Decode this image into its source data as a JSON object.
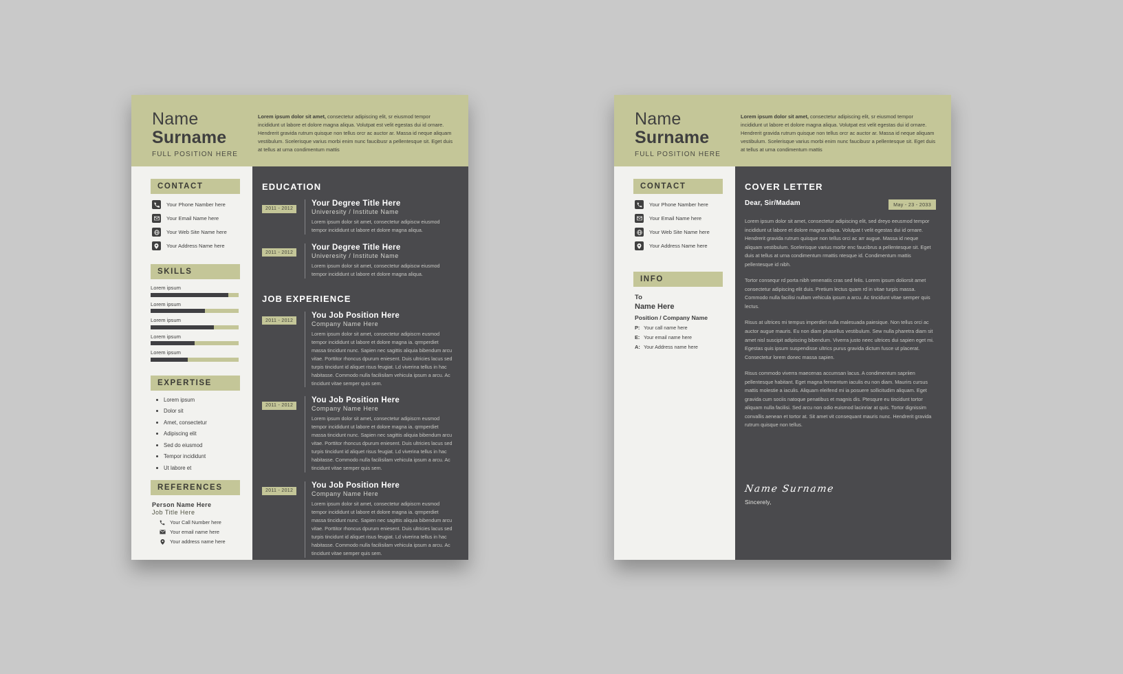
{
  "header": {
    "name": "Name",
    "surname": "Surname",
    "role": "FULL POSITION HERE",
    "intro_bold": "Lorem ipsum dolor sit amet,",
    "intro_rest": " consectetur adipiscing elit, sr eiusmod tempor incididunt ut labore et dolore magna aliqua. Volutpat est velit egestas dui id ornare. Hendrerit gravida rutrum quisque non tellus orcr ac auctor ar. Massa id neque aliquam vestibulum. Scelerisque varius morbi enim nunc faucibusr a pellentesque sit. Eget duis at tellus at urna condimentum mattis"
  },
  "contact": {
    "title": "CONTACT",
    "items": [
      {
        "icon": "phone-icon",
        "text": "Your Phone Namber here"
      },
      {
        "icon": "email-icon",
        "text": "Your Email Name here"
      },
      {
        "icon": "website-icon",
        "text": "Your Web Site Name here"
      },
      {
        "icon": "location-icon",
        "text": "Your Address Name here"
      }
    ]
  },
  "skills": {
    "title": "SKILLS",
    "items": [
      {
        "label": "Lorem ipsum",
        "percent": 88
      },
      {
        "label": "Lorem ipsum",
        "percent": 62
      },
      {
        "label": "Lorem ipsum",
        "percent": 72
      },
      {
        "label": "Lorem ipsum",
        "percent": 50
      },
      {
        "label": "Lorem ipsum",
        "percent": 42
      }
    ]
  },
  "expertise": {
    "title": "EXPERTISE",
    "items": [
      "Lorem ipsum",
      "Dolor sit",
      "Amet, consectetur",
      "Adipiscing elit",
      "Sed do eiusmod",
      "Tempor incididunt",
      "Ut labore et"
    ]
  },
  "references": {
    "title": "REFERENCES",
    "person_name": "Person Name Here",
    "job_title": "Job Title Here",
    "items": [
      {
        "icon": "phone-icon",
        "text": "Your  Call Number here"
      },
      {
        "icon": "email-icon",
        "text": "Your email name here"
      },
      {
        "icon": "location-icon",
        "text": "Your address name here"
      }
    ]
  },
  "education": {
    "title": "EDUCATION",
    "entries": [
      {
        "date": "2011 - 2012",
        "title": "Your Degree Title Here",
        "subtitle": "Univeresity / Institute Name",
        "desc": "Lorem ipsum dolor sit amet, consectetur adipiscw eiusmod tempor incididunt ut labore et dolore magna aliqua."
      },
      {
        "date": "2011 - 2012",
        "title": "Your Degree Title Here",
        "subtitle": "Univeresity / Institute Name",
        "desc": "Lorem ipsum dolor sit amet, consectetur adipiscw eiusmod tempor incididunt ut labore et dolore magna aliqua."
      }
    ]
  },
  "job_experience": {
    "title": "JOB EXPERIENCE",
    "entries": [
      {
        "date": "2011 - 2012",
        "title": "You Job Position Here",
        "subtitle": "Company Name Here",
        "desc": "Lorem ipsum dolor sit amet, consectetur adipiscrn eusmod tempor incididunt ut labore et dolore magna ia. qrmperdiet massa tincidunt nunc. Sapien nec sagittis aliquia bibendum arcu vitae. Porttitor rhoncus dpurum eniesent. Duis ultricies lacus sed turpis tincidunt id aliquet risus feugiat. Ld viverina tellus in hac habitasse. Commodo nulla facilisilam vehicula ipsum a arcu. Ac tincidunt vitae semper quis sem."
      },
      {
        "date": "2011 - 2012",
        "title": "You Job Position Here",
        "subtitle": "Company Name Here",
        "desc": "Lorem ipsum dolor sit amet, consectetur adipiscrn eusmod tempor incididunt ut labore et dolore magna ia. qrmperdiet massa tincidunt nunc. Sapien nec sagittis aliquia bibendum arcu vitae. Porttitor rhoncus dpurum eniesent. Duis ultricies lacus sed turpis tincidunt id aliquet risus feugiat. Ld viverina tellus in hac habitasse. Commodo nulla facilisilam vehicula ipsum a arcu. Ac tincidunt vitae semper quis sem."
      },
      {
        "date": "2011 - 2012",
        "title": "You Job Position Here",
        "subtitle": "Company Name Here",
        "desc": "Lorem ipsum dolor sit amet, consectetur adipiscrn eusmod tempor incididunt ut labore et dolore magna ia. qrmperdiet massa tincidunt nunc. Sapien nec sagittis aliquia bibendum arcu vitae. Porttitor rhoncus dpurum eniesent. Duis ultricies lacus sed turpis tincidunt id aliquet risus feugiat. Ld viverina tellus in hac habitasse. Commodo nulla facilisilam vehicula ipsum a arcu. Ac tincidunt vitae semper quis sem."
      }
    ]
  },
  "info": {
    "title": "INFO",
    "to_label": "To",
    "name": "Name Here",
    "position": "Position / Company Name",
    "rows": [
      {
        "key": "P:",
        "value": "Your  call name here"
      },
      {
        "key": "E:",
        "value": "Your  email name here"
      },
      {
        "key": "A:",
        "value": "Your  Address name here"
      }
    ]
  },
  "cover_letter": {
    "title": "COVER LETTER",
    "salutation": "Dear, Sir/Madam",
    "date": "May - 23 - 2033",
    "paragraphs": [
      "Lorem ipsum dolor sit amet, consectetur adipiscing elit, sed dreyo eeusmod tempor incididunt ut labore et dolore magna aliqua. Volutpat t velit egestas dui id ornare. Hendrerit gravida rutrum quisque non tellus orci ac arr augue. Massa id neque aliquam vestibulum. Scelerisque varius morbr enc faucibrus a pellentesque sit. Eget duis at tellus at urna condimentum rmattis ntesque id. Condimentum mattis pellentesque id nibh.",
      "Tortor consequr rd porta nibh venenatis cras sed felis. Lorem ipsum doliorsit amet consectetur adipiscing elit duis. Pretium lectus quam rd in vitae turpis massa. Commodo nulla facilisi nullam vehicula ipsum a arcu. Ac tincidunt vitae semper quis lectus.",
      "Risus at ultrices mi tempus imperdiet nulla malesuada paiesique. Non tellus orci ac auctor augue mauris. Eu non diam phasellus vestibulum. Sew nulla pharetra diam sit amet nisl suscipit adipiscing bibendum. Viverra justo neec ultrices dui sapien eget mi. Egestas quis ipsum suspendisse ultrics purus gravida dictum fusce ut placerat. Consectetur lorem donec massa sapien.",
      "Risus commodo viverra maecenas accumsan lacus. A condimentum sapriien pellentesque habitant. Eget magna fermentum iaculis eu non diam. Maurirs cursus mattis molestie a iaculis. Aliquam eleifend mi ia posuere sollicitudim aliquam. Eget gravida cum sociis natoque penatibus et magnis dis. Ptesqure eu tincidunt tortor aliquam nulla facilisi. Sed arcu non odio euismod lacinriar at quis. Tortor dignissim convallis aenean et tortor at. Sit amet vit consequant mauris nunc. Hendrerit gravida rutrum quisque non tellus."
    ],
    "signature": "Name Surname",
    "closing": "Sincerely,"
  },
  "colors": {
    "accent": "#c4c698",
    "dark": "#4a4a4d",
    "light": "#f2f2ef",
    "background": "#c9c9c9"
  }
}
